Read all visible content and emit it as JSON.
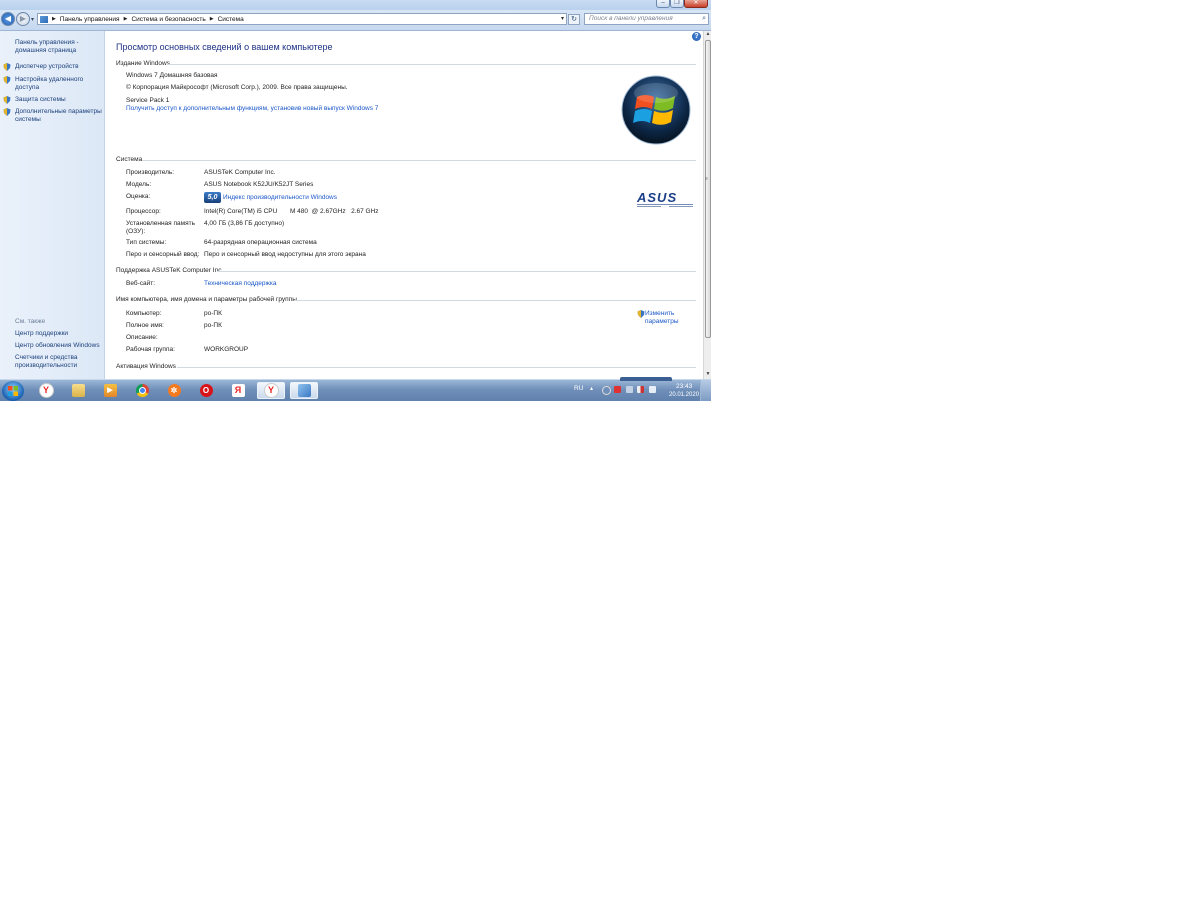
{
  "address": {
    "crumbs": [
      "Панель управления",
      "Система и безопасность",
      "Система"
    ],
    "search_placeholder": "Поиск в панели управления"
  },
  "sidebar": {
    "home": "Панель управления - домашняя страница",
    "items": [
      {
        "label": "Диспетчер устройств"
      },
      {
        "label": "Настройка удаленного доступа"
      },
      {
        "label": "Защита системы"
      },
      {
        "label": "Дополнительные параметры системы"
      }
    ],
    "see_also_title": "См. также",
    "see_also": [
      {
        "label": "Центр поддержки"
      },
      {
        "label": "Центр обновления Windows"
      },
      {
        "label": "Счетчики и средства производительности"
      }
    ]
  },
  "main": {
    "title": "Просмотр основных сведений о вашем компьютере",
    "edition": {
      "heading": "Издание Windows",
      "name": "Windows 7 Домашняя базовая",
      "copyright": "© Корпорация Майкрософт (Microsoft Corp.), 2009. Все права защищены.",
      "service_pack": "Service Pack 1",
      "upgrade_link": "Получить доступ к дополнительным функциям, установив новый выпуск Windows 7"
    },
    "system": {
      "heading": "Система",
      "manufacturer_label": "Производитель:",
      "manufacturer": "ASUSTeK Computer Inc.",
      "model_label": "Модель:",
      "model": "ASUS Notebook K52JU/K52JT Series",
      "rating_label": "Оценка:",
      "rating_score": "5,0",
      "rating_link": "Индекс производительности Windows",
      "processor_label": "Процессор:",
      "processor": "Intel(R) Core(TM) i5 CPU       M 480  @ 2.67GHz   2.67 GHz",
      "memory_label": "Установленная память (ОЗУ):",
      "memory": "4,00 ГБ (3,86 ГБ доступно)",
      "type_label": "Тип системы:",
      "type": "64-разрядная операционная система",
      "pen_label": "Перо и сенсорный ввод:",
      "pen": "Перо и сенсорный ввод недоступны для этого экрана"
    },
    "support": {
      "heading": "Поддержка ASUSTeK Computer Inc.",
      "website_label": "Веб-сайт:",
      "website": "Техническая поддержка"
    },
    "computer": {
      "heading": "Имя компьютера, имя домена и параметры рабочей группы",
      "name_label": "Компьютер:",
      "name": "ро-ПК",
      "full_label": "Полное имя:",
      "full": "ро-ПК",
      "desc_label": "Описание:",
      "workgroup_label": "Рабочая группа:",
      "workgroup": "WORKGROUP",
      "change_link": "Изменить параметры"
    },
    "activation": {
      "heading": "Активация Windows"
    }
  },
  "taskbar": {
    "lang": "RU",
    "time": "23:43",
    "date": "20.01.2020",
    "apps": [
      {
        "name": "yandex-browser"
      },
      {
        "name": "file-explorer"
      },
      {
        "name": "media-player"
      },
      {
        "name": "google-chrome"
      },
      {
        "name": "ok-app"
      },
      {
        "name": "opera"
      },
      {
        "name": "yandex"
      },
      {
        "name": "yandex-browser-active"
      },
      {
        "name": "control-panel"
      }
    ]
  },
  "colors": {
    "link": "#1a56c8",
    "title": "#1e3287",
    "taskbar": "#6f8fb9"
  }
}
